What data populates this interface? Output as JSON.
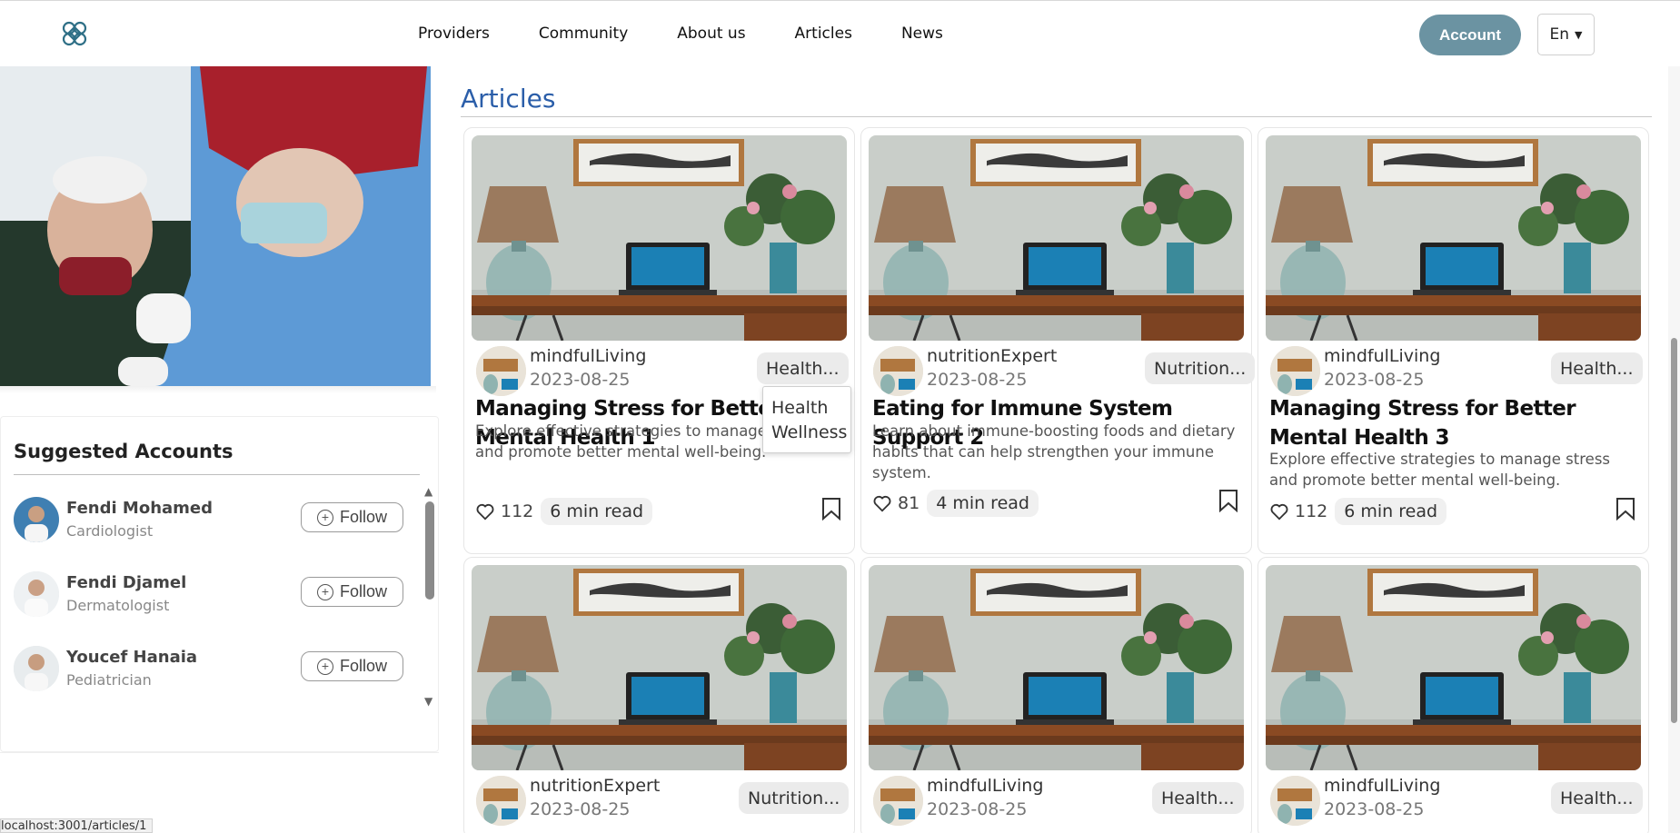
{
  "header": {
    "nav": [
      "Providers",
      "Community",
      "About us",
      "Articles",
      "News"
    ],
    "account_label": "Account",
    "language": "En"
  },
  "suggested": {
    "title": "Suggested Accounts",
    "follow_label": "Follow",
    "accounts": [
      {
        "name": "Fendi Mohamed",
        "specialty": "Cardiologist"
      },
      {
        "name": "Fendi Djamel",
        "specialty": "Dermatologist"
      },
      {
        "name": "Youcef Hanaia",
        "specialty": "Pediatrician"
      }
    ]
  },
  "articles": {
    "title": "Articles",
    "cards": [
      {
        "user": "mindfulLiving",
        "date": "2023-08-25",
        "tag": "Health...",
        "title": "Managing Stress for Better Mental Health 1",
        "desc": "Explore effective strategies to manage stress and promote better mental well-being.",
        "likes": "112",
        "read": "6 min read"
      },
      {
        "user": "nutritionExpert",
        "date": "2023-08-25",
        "tag": "Nutrition...",
        "title": "Eating for Immune System Support 2",
        "desc": "Learn about immune-boosting foods and dietary habits that can help strengthen your immune system.",
        "likes": "81",
        "read": "4 min read"
      },
      {
        "user": "mindfulLiving",
        "date": "2023-08-25",
        "tag": "Health...",
        "title": "Managing Stress for Better Mental Health 3",
        "desc": "Explore effective strategies to manage stress and promote better mental well-being.",
        "likes": "112",
        "read": "6 min read"
      },
      {
        "user": "nutritionExpert",
        "date": "2023-08-25",
        "tag": "Nutrition..."
      },
      {
        "user": "mindfulLiving",
        "date": "2023-08-25",
        "tag": "Health..."
      },
      {
        "user": "mindfulLiving",
        "date": "2023-08-25",
        "tag": "Health..."
      }
    ],
    "tag_dropdown": [
      "Health",
      "Wellness"
    ]
  },
  "status_url": "localhost:3001/articles/1"
}
